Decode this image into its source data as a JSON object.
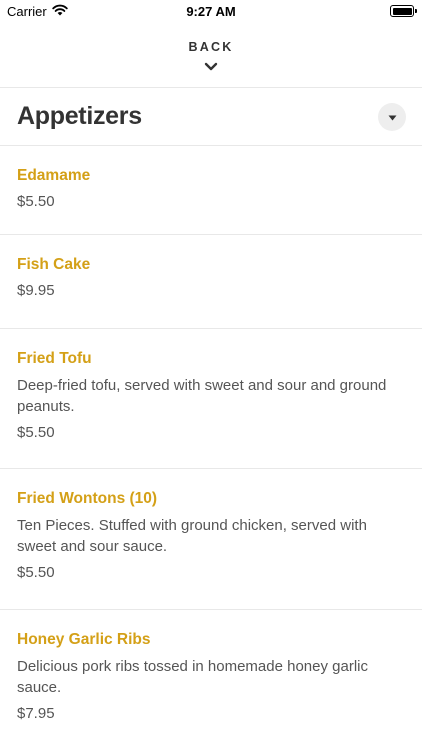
{
  "status_bar": {
    "carrier": "Carrier",
    "time": "9:27 AM"
  },
  "nav": {
    "back_label": "BACK"
  },
  "category": {
    "title": "Appetizers"
  },
  "items": [
    {
      "name": "Edamame",
      "description": "",
      "price": "$5.50"
    },
    {
      "name": "Fish Cake",
      "description": "",
      "price": "$9.95"
    },
    {
      "name": "Fried Tofu",
      "description": "Deep-fried tofu, served with sweet and sour and ground peanuts.",
      "price": "$5.50"
    },
    {
      "name": "Fried Wontons (10)",
      "description": "Ten Pieces. Stuffed with ground chicken, served with sweet and sour sauce.",
      "price": "$5.50"
    },
    {
      "name": "Honey Garlic Ribs",
      "description": "Delicious pork ribs tossed in homemade honey garlic sauce.",
      "price": "$7.95"
    }
  ],
  "colors": {
    "accent": "#d4a017",
    "divider": "#e8e8e8"
  },
  "icons": {
    "back": "chevron-down-icon",
    "dropdown": "caret-down-icon",
    "wifi": "wifi-icon",
    "battery": "battery-icon"
  }
}
